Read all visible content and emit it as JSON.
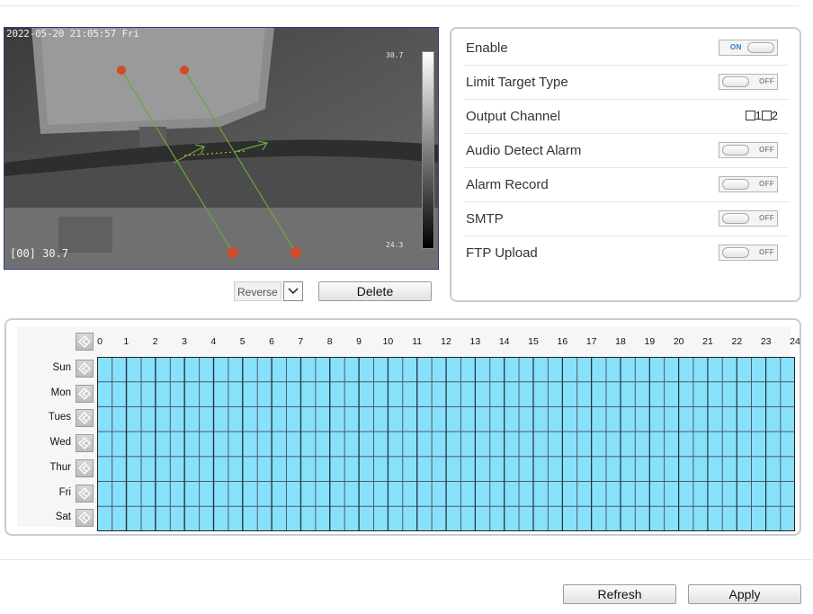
{
  "video": {
    "timestamp": "2022-05-20 21:05:57 Fri",
    "temp_readout": "[00] 30.7",
    "scale_max": "30.7",
    "scale_min": "24.3"
  },
  "video_controls": {
    "reverse_label": "Reverse",
    "delete_label": "Delete"
  },
  "settings": {
    "rows": [
      {
        "label": "Enable",
        "control": "toggle",
        "state": "ON"
      },
      {
        "label": "Limit Target Type",
        "control": "toggle",
        "state": "OFF"
      },
      {
        "label": "Output Channel",
        "control": "checkboxes",
        "options": [
          "1",
          "2"
        ]
      },
      {
        "label": "Audio Detect Alarm",
        "control": "toggle",
        "state": "OFF"
      },
      {
        "label": "Alarm Record",
        "control": "toggle",
        "state": "OFF"
      },
      {
        "label": "SMTP",
        "control": "toggle",
        "state": "OFF"
      },
      {
        "label": "FTP Upload",
        "control": "toggle",
        "state": "OFF"
      }
    ]
  },
  "schedule": {
    "hours": [
      "0",
      "1",
      "2",
      "3",
      "4",
      "5",
      "6",
      "7",
      "8",
      "9",
      "10",
      "11",
      "12",
      "13",
      "14",
      "15",
      "16",
      "17",
      "18",
      "19",
      "20",
      "21",
      "22",
      "23",
      "24"
    ],
    "days": [
      "Sun",
      "Mon",
      "Tues",
      "Wed",
      "Thur",
      "Fri",
      "Sat"
    ],
    "selected_color": "#87e1fb"
  },
  "footer": {
    "refresh_label": "Refresh",
    "apply_label": "Apply"
  }
}
